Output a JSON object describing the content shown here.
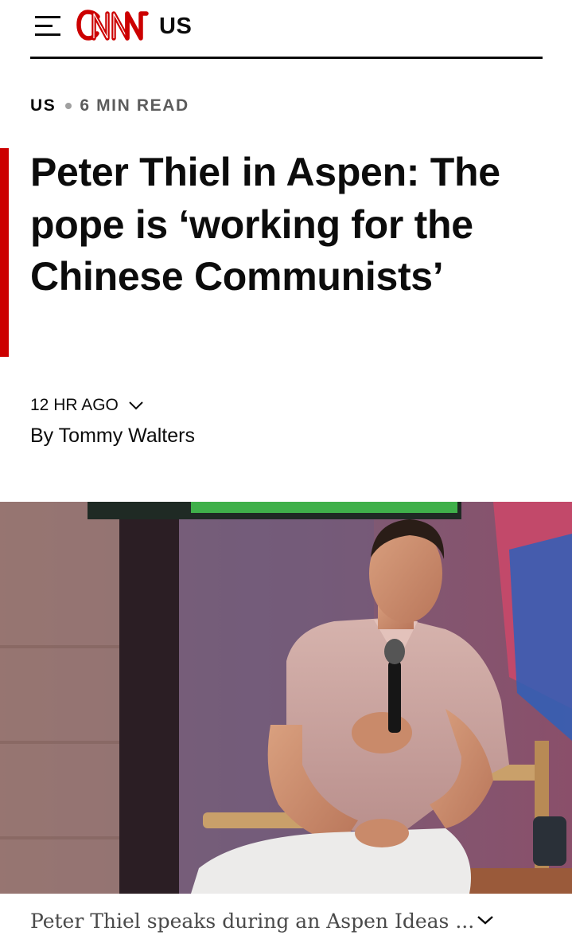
{
  "header": {
    "menu_icon": "hamburger-menu-icon",
    "logo_text": "CNN",
    "section": "US",
    "brand_color": "#cc0000"
  },
  "article": {
    "eyebrow": {
      "section": "US",
      "read_time": "6 MIN READ"
    },
    "headline": "Peter Thiel in Aspen: The pope is ‘working for the Chinese Communists’",
    "timestamp": "12 HR AGO",
    "timestamp_icon": "chevron-down-icon",
    "byline_prefix": "By",
    "author": "Tommy Walters",
    "image": {
      "caption": "Peter Thiel speaks during an Aspen Ideas ...",
      "caption_icon": "chevron-down-icon"
    }
  },
  "colors": {
    "accent_bar": "#cc0000",
    "text": "#0c0c0c",
    "caption_text": "#4a4a4a"
  }
}
